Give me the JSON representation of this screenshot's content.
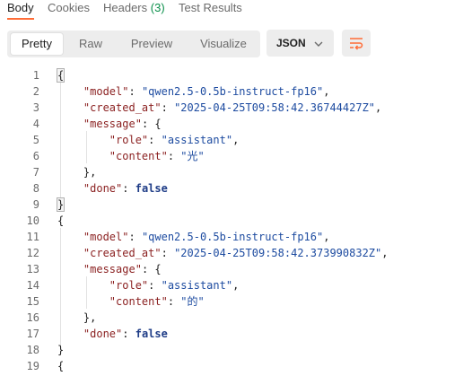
{
  "response_tabs": [
    {
      "label": "Body",
      "active": true
    },
    {
      "label": "Cookies",
      "active": false
    },
    {
      "label": "Headers",
      "count": "(3)",
      "active": false
    },
    {
      "label": "Test Results",
      "active": false
    }
  ],
  "toolbar": {
    "format_buttons": [
      {
        "label": "Pretty",
        "active": true
      },
      {
        "label": "Raw",
        "active": false
      },
      {
        "label": "Preview",
        "active": false
      },
      {
        "label": "Visualize",
        "active": false
      }
    ],
    "language_select": "JSON",
    "icons": {
      "dropdown": "chevron-down-icon",
      "wrap": "text-wrap-icon"
    },
    "accent_color": "#ff6c37"
  },
  "code_lines": [
    {
      "n": "1",
      "tokens": [
        [
          "p",
          "{"
        ]
      ]
    },
    {
      "n": "2",
      "tokens": [
        [
          "p",
          "    "
        ],
        [
          "k",
          "\"model\""
        ],
        [
          "p",
          ": "
        ],
        [
          "s",
          "\"qwen2.5-0.5b-instruct-fp16\""
        ],
        [
          "p",
          ","
        ]
      ]
    },
    {
      "n": "3",
      "tokens": [
        [
          "p",
          "    "
        ],
        [
          "k",
          "\"created_at\""
        ],
        [
          "p",
          ": "
        ],
        [
          "s",
          "\"2025-04-25T09:58:42.36744427Z\""
        ],
        [
          "p",
          ","
        ]
      ]
    },
    {
      "n": "4",
      "tokens": [
        [
          "p",
          "    "
        ],
        [
          "k",
          "\"message\""
        ],
        [
          "p",
          ": {"
        ]
      ]
    },
    {
      "n": "5",
      "tokens": [
        [
          "p",
          "        "
        ],
        [
          "k",
          "\"role\""
        ],
        [
          "p",
          ": "
        ],
        [
          "s",
          "\"assistant\""
        ],
        [
          "p",
          ","
        ]
      ]
    },
    {
      "n": "6",
      "tokens": [
        [
          "p",
          "        "
        ],
        [
          "k",
          "\"content\""
        ],
        [
          "p",
          ": "
        ],
        [
          "s",
          "\"光\""
        ]
      ]
    },
    {
      "n": "7",
      "tokens": [
        [
          "p",
          "    },"
        ]
      ]
    },
    {
      "n": "8",
      "tokens": [
        [
          "p",
          "    "
        ],
        [
          "k",
          "\"done\""
        ],
        [
          "p",
          ": "
        ],
        [
          "b",
          "false"
        ]
      ]
    },
    {
      "n": "9",
      "tokens": [
        [
          "p",
          "}"
        ]
      ]
    },
    {
      "n": "10",
      "tokens": [
        [
          "p",
          "{"
        ]
      ]
    },
    {
      "n": "11",
      "tokens": [
        [
          "p",
          "    "
        ],
        [
          "k",
          "\"model\""
        ],
        [
          "p",
          ": "
        ],
        [
          "s",
          "\"qwen2.5-0.5b-instruct-fp16\""
        ],
        [
          "p",
          ","
        ]
      ]
    },
    {
      "n": "12",
      "tokens": [
        [
          "p",
          "    "
        ],
        [
          "k",
          "\"created_at\""
        ],
        [
          "p",
          ": "
        ],
        [
          "s",
          "\"2025-04-25T09:58:42.373990832Z\""
        ],
        [
          "p",
          ","
        ]
      ]
    },
    {
      "n": "13",
      "tokens": [
        [
          "p",
          "    "
        ],
        [
          "k",
          "\"message\""
        ],
        [
          "p",
          ": {"
        ]
      ]
    },
    {
      "n": "14",
      "tokens": [
        [
          "p",
          "        "
        ],
        [
          "k",
          "\"role\""
        ],
        [
          "p",
          ": "
        ],
        [
          "s",
          "\"assistant\""
        ],
        [
          "p",
          ","
        ]
      ]
    },
    {
      "n": "15",
      "tokens": [
        [
          "p",
          "        "
        ],
        [
          "k",
          "\"content\""
        ],
        [
          "p",
          ": "
        ],
        [
          "s",
          "\"的\""
        ]
      ]
    },
    {
      "n": "16",
      "tokens": [
        [
          "p",
          "    },"
        ]
      ]
    },
    {
      "n": "17",
      "tokens": [
        [
          "p",
          "    "
        ],
        [
          "k",
          "\"done\""
        ],
        [
          "p",
          ": "
        ],
        [
          "b",
          "false"
        ]
      ]
    },
    {
      "n": "18",
      "tokens": [
        [
          "p",
          "}"
        ]
      ]
    },
    {
      "n": "19",
      "tokens": [
        [
          "p",
          "{"
        ]
      ]
    }
  ]
}
